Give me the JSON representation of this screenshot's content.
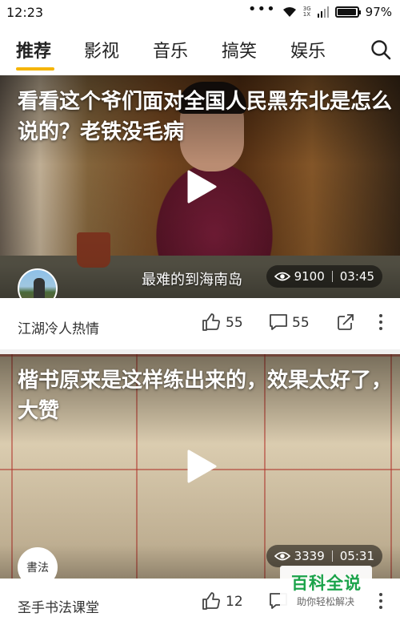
{
  "status_bar": {
    "time": "12:23",
    "network_top": "3G",
    "network_bottom": "1X",
    "battery_percent": "97%",
    "battery_level": 0.97
  },
  "tabs": {
    "items": [
      {
        "label": "推荐",
        "active": true
      },
      {
        "label": "影视",
        "active": false
      },
      {
        "label": "音乐",
        "active": false
      },
      {
        "label": "搞笑",
        "active": false
      },
      {
        "label": "娱乐",
        "active": false
      }
    ],
    "accent_color": "#f5b400",
    "search_icon": "search-icon"
  },
  "feed": [
    {
      "title": "看看这个爷们面对全国人民黑东北是怎么说的？老铁没毛病",
      "subtitle": "最难的到海南岛",
      "views": "9100",
      "duration": "03:45",
      "author": "江湖冷人热情",
      "likes": "55",
      "comments": "55"
    },
    {
      "title": "楷书原来是这样练出来的，效果太好了，大赞",
      "views": "3339",
      "duration": "05:31",
      "author": "圣手书法课堂",
      "avatar_text": "書法",
      "likes": "12",
      "comments": ""
    }
  ],
  "watermark": {
    "title": "百科全说",
    "subtitle": "助你轻松解决",
    "color": "#1ba34a"
  }
}
